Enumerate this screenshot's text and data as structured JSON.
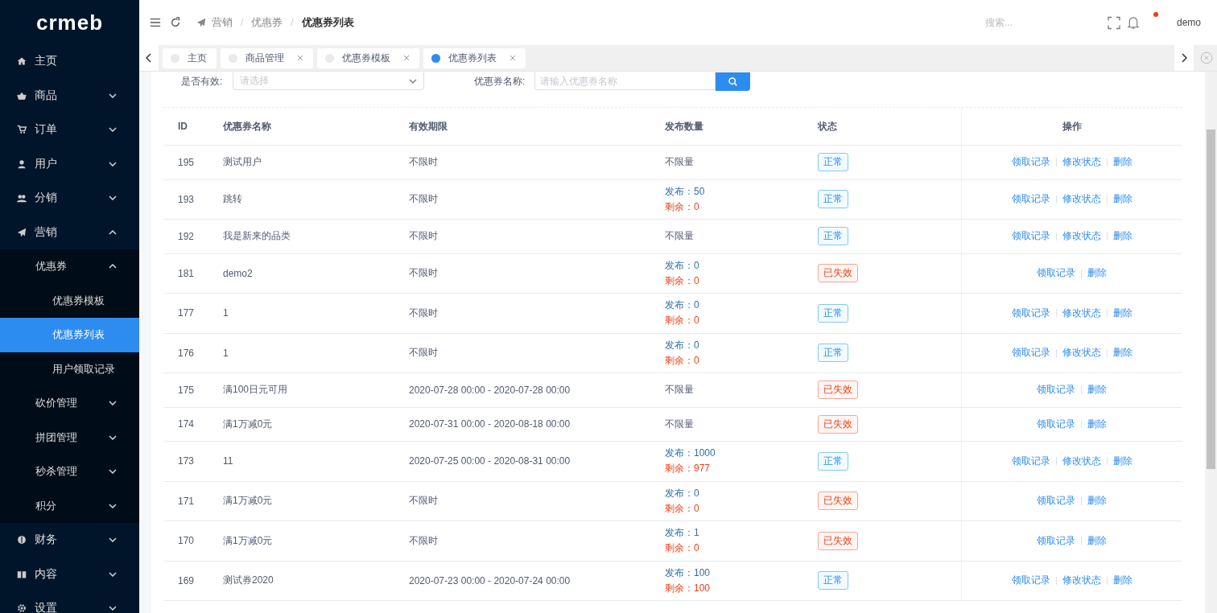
{
  "logo": "crmeb",
  "sidebar": {
    "items": [
      {
        "label": "主页",
        "selected": false
      },
      {
        "label": "商品",
        "expanded": false,
        "selected": false
      },
      {
        "label": "订单",
        "expanded": false,
        "selected": false
      },
      {
        "label": "用户",
        "expanded": false,
        "selected": false
      },
      {
        "label": "分销",
        "expanded": false,
        "selected": false
      },
      {
        "label": "营销",
        "expanded": true,
        "selected": false,
        "children": [
          {
            "label": "优惠券",
            "expanded": true,
            "selected": false,
            "children": [
              {
                "label": "优惠券模板",
                "selected": false
              },
              {
                "label": "优惠券列表",
                "selected": true
              },
              {
                "label": "用户领取记录",
                "selected": false
              }
            ]
          },
          {
            "label": "砍价管理",
            "expanded": false,
            "selected": false
          },
          {
            "label": "拼团管理",
            "expanded": false,
            "selected": false
          },
          {
            "label": "秒杀管理",
            "expanded": false,
            "selected": false
          },
          {
            "label": "积分",
            "expanded": false,
            "selected": false
          }
        ]
      },
      {
        "label": "财务",
        "expanded": false,
        "selected": false
      },
      {
        "label": "内容",
        "expanded": false,
        "selected": false
      },
      {
        "label": "设置",
        "expanded": false,
        "selected": false
      }
    ]
  },
  "breadcrumb": [
    "营销",
    "优惠券",
    "优惠券列表"
  ],
  "breadcrumb_separator": "/",
  "header": {
    "search_placeholder": "搜索...",
    "has_notification": true,
    "user": "demo"
  },
  "tabs": [
    {
      "label": "主页",
      "selected": false,
      "closable": false
    },
    {
      "label": "商品管理",
      "selected": false,
      "closable": true
    },
    {
      "label": "优惠券模板",
      "selected": false,
      "closable": true
    },
    {
      "label": "优惠券列表",
      "selected": true,
      "closable": true
    }
  ],
  "filters": {
    "valid_label": "是否有效:",
    "valid_placeholder": "请选择",
    "name_label": "优惠券名称:",
    "name_placeholder": "请输入优惠券名称"
  },
  "table": {
    "columns": [
      "ID",
      "优惠券名称",
      "有效期限",
      "发布数量",
      "状态",
      "操作"
    ],
    "rows": [
      {
        "id": "195",
        "name": "测试用户",
        "validity": "不限时",
        "quantity": {
          "kind": "text",
          "text": "不限量"
        },
        "status": {
          "kind": "normal",
          "label": "正常"
        },
        "actions": [
          "领取记录",
          "修改状态",
          "删除"
        ]
      },
      {
        "id": "193",
        "name": "跳转",
        "validity": "不限时",
        "quantity": {
          "kind": "counts",
          "issued": "发布：50",
          "remaining": "剩余：0"
        },
        "status": {
          "kind": "normal",
          "label": "正常"
        },
        "actions": [
          "领取记录",
          "修改状态",
          "删除"
        ]
      },
      {
        "id": "192",
        "name": "我是新来的品类",
        "validity": "不限时",
        "quantity": {
          "kind": "text",
          "text": "不限量"
        },
        "status": {
          "kind": "normal",
          "label": "正常"
        },
        "actions": [
          "领取记录",
          "修改状态",
          "删除"
        ]
      },
      {
        "id": "181",
        "name": "demo2",
        "validity": "不限时",
        "quantity": {
          "kind": "counts",
          "issued": "发布：0",
          "remaining": "剩余：0"
        },
        "status": {
          "kind": "expired",
          "label": "已失效"
        },
        "actions": [
          "领取记录",
          "删除"
        ]
      },
      {
        "id": "177",
        "name": "1",
        "validity": "不限时",
        "quantity": {
          "kind": "counts",
          "issued": "发布：0",
          "remaining": "剩余：0"
        },
        "status": {
          "kind": "normal",
          "label": "正常"
        },
        "actions": [
          "领取记录",
          "修改状态",
          "删除"
        ]
      },
      {
        "id": "176",
        "name": "1",
        "validity": "不限时",
        "quantity": {
          "kind": "counts",
          "issued": "发布：0",
          "remaining": "剩余：0"
        },
        "status": {
          "kind": "normal",
          "label": "正常"
        },
        "actions": [
          "领取记录",
          "修改状态",
          "删除"
        ]
      },
      {
        "id": "175",
        "name": "满100日元可用",
        "validity": "2020-07-28 00:00 - 2020-07-28 00:00",
        "quantity": {
          "kind": "text",
          "text": "不限量"
        },
        "status": {
          "kind": "expired",
          "label": "已失效"
        },
        "actions": [
          "领取记录",
          "删除"
        ]
      },
      {
        "id": "174",
        "name": "满1万减0元",
        "validity": "2020-07-31 00:00 - 2020-08-18 00:00",
        "quantity": {
          "kind": "text",
          "text": "不限量"
        },
        "status": {
          "kind": "expired",
          "label": "已失效"
        },
        "actions": [
          "领取记录",
          "删除"
        ]
      },
      {
        "id": "173",
        "name": "11",
        "validity": "2020-07-25 00:00 - 2020-08-31 00:00",
        "quantity": {
          "kind": "counts",
          "issued": "发布：1000",
          "remaining": "剩余：977"
        },
        "status": {
          "kind": "normal",
          "label": "正常"
        },
        "actions": [
          "领取记录",
          "修改状态",
          "删除"
        ]
      },
      {
        "id": "171",
        "name": "满1万减0元",
        "validity": "不限时",
        "quantity": {
          "kind": "counts",
          "issued": "发布：0",
          "remaining": "剩余：0"
        },
        "status": {
          "kind": "expired",
          "label": "已失效"
        },
        "actions": [
          "领取记录",
          "删除"
        ]
      },
      {
        "id": "170",
        "name": "满1万减0元",
        "validity": "不限时",
        "quantity": {
          "kind": "counts",
          "issued": "发布：1",
          "remaining": "剩余：0"
        },
        "status": {
          "kind": "expired",
          "label": "已失效"
        },
        "actions": [
          "领取记录",
          "删除"
        ]
      },
      {
        "id": "169",
        "name": "测试券2020",
        "validity": "2020-07-23 00:00 - 2020-07-24 00:00",
        "quantity": {
          "kind": "counts",
          "issued": "发布：100",
          "remaining": "剩余：100"
        },
        "status": {
          "kind": "normal",
          "label": "正常"
        },
        "actions": [
          "领取记录",
          "修改状态",
          "删除"
        ]
      }
    ]
  }
}
